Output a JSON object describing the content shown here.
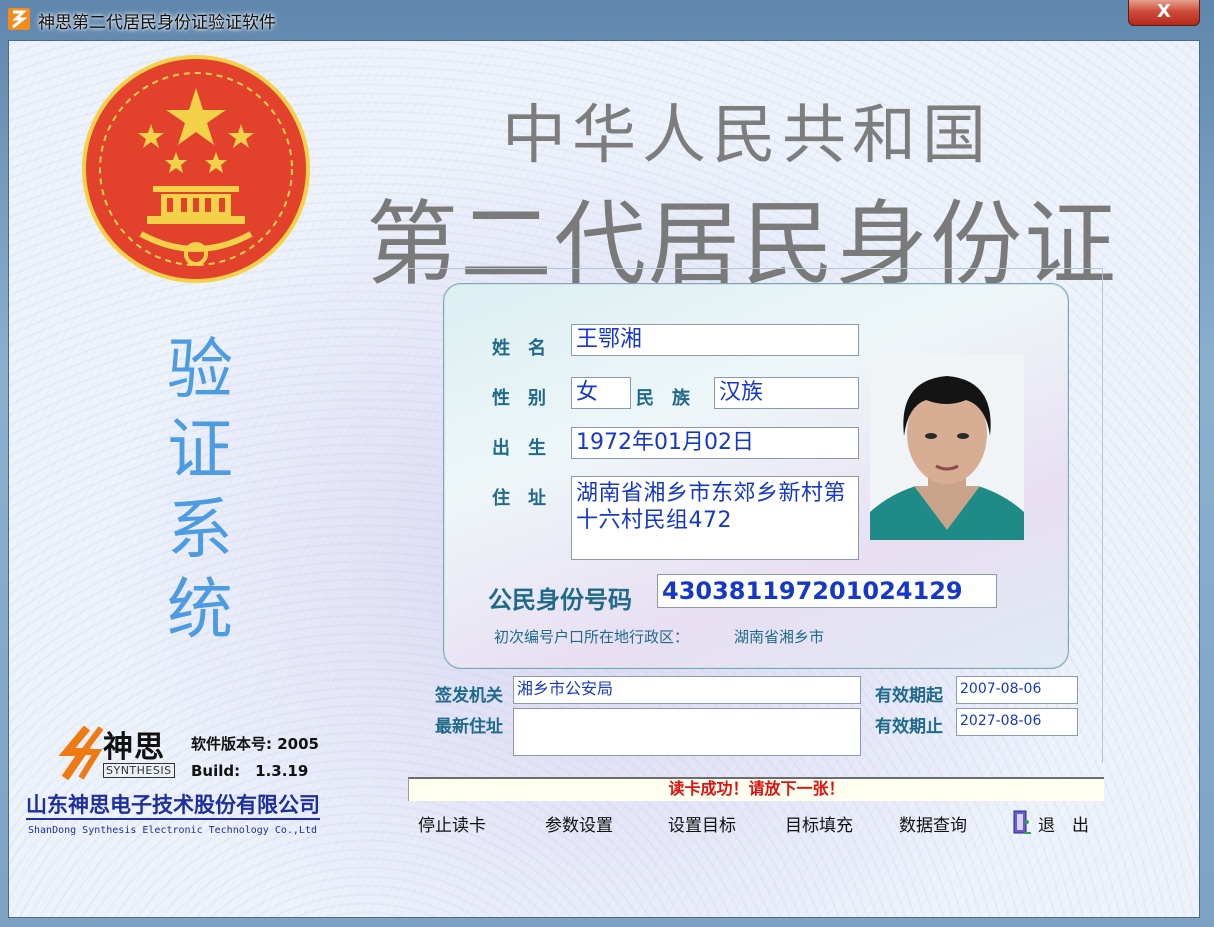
{
  "window": {
    "title": "神思第二代居民身份证验证软件",
    "close_glyph": "X"
  },
  "header": {
    "line1": "中华人民共和国",
    "line2": "第二代居民身份证"
  },
  "side_title": [
    "验",
    "证",
    "系",
    "统"
  ],
  "card": {
    "name_label": "姓　名",
    "name": "王鄂湘",
    "gender_label": "性　别",
    "gender": "女",
    "ethnicity_label": "民　族",
    "ethnicity": "汉族",
    "birth_label": "出　生",
    "birth": "1972年01月02日",
    "address_label": "住　址",
    "address": "湖南省湘乡市东郊乡新村第十六村民组472",
    "id_label": "公民身份号码",
    "id_number": "430381197201024129",
    "origin_label": "初次编号户口所在地行政区：",
    "origin_value": "湖南省湘乡市"
  },
  "extra": {
    "authority_label": "签发机关",
    "authority": "湘乡市公安局",
    "new_address_label": "最新住址",
    "new_address": "",
    "valid_from_label": "有效期起",
    "valid_from": "2007-08-06",
    "valid_to_label": "有效期止",
    "valid_to": "2027-08-06"
  },
  "status": "读卡成功！请放下一张！",
  "menu": {
    "stop": "停止读卡",
    "params": "参数设置",
    "set_target": "设置目标",
    "fill_target": "目标填充",
    "query": "数据查询",
    "exit": "退　出"
  },
  "branding": {
    "logo_cn": "神思",
    "logo_en": "SYNTHESIS",
    "version": "软件版本号: 2005",
    "build": "Build:　1.3.19",
    "company_cn": "山东神思电子技术股份有限公司",
    "company_en": "ShanDong Synthesis Electronic Technology Co.,Ltd"
  },
  "colors": {
    "card_label": "#1f6a8a",
    "field_text": "#1638c8",
    "status_text": "#e01010",
    "company_text": "#1d2f9c",
    "side_title": "#4d9be0",
    "emblem_red": "#e2412c",
    "emblem_gold": "#f3d24a"
  }
}
